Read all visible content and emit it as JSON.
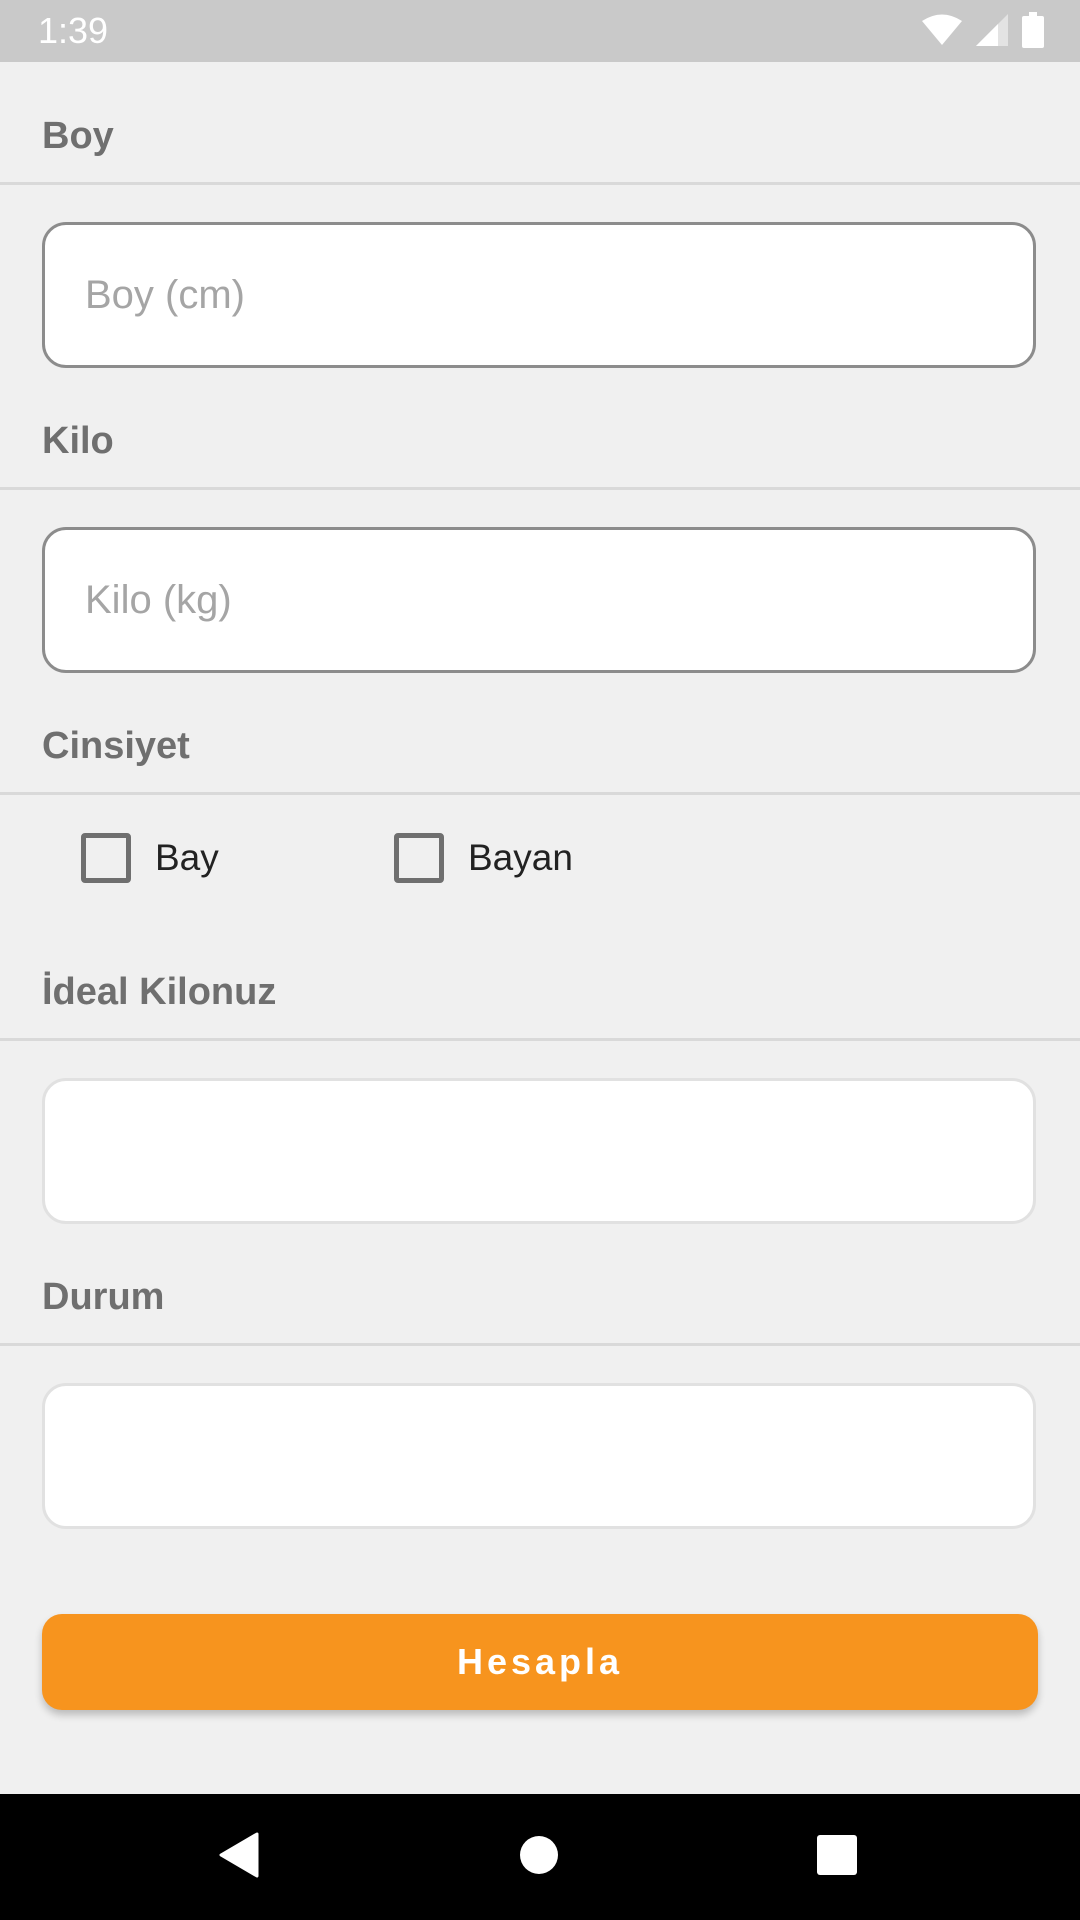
{
  "status_bar": {
    "time": "1:39",
    "icons": [
      "wifi-icon",
      "cell-signal-icon",
      "battery-icon"
    ]
  },
  "form": {
    "height": {
      "label": "Boy",
      "placeholder": "Boy (cm)",
      "value": ""
    },
    "weight": {
      "label": "Kilo",
      "placeholder": "Kilo (kg)",
      "value": ""
    },
    "gender": {
      "label": "Cinsiyet",
      "options": [
        {
          "label": "Bay",
          "checked": false
        },
        {
          "label": "Bayan",
          "checked": false
        }
      ]
    },
    "ideal_weight": {
      "label": "İdeal Kilonuz",
      "value": ""
    },
    "status": {
      "label": "Durum",
      "value": ""
    },
    "submit_label": "Hesapla"
  },
  "nav_bar": {
    "buttons": [
      "back-icon",
      "home-icon",
      "recents-icon"
    ]
  },
  "colors": {
    "accent": "#f7941e",
    "background": "#f0f0f0",
    "status_bar": "#c9c9c9",
    "label": "#6f6f6f"
  }
}
